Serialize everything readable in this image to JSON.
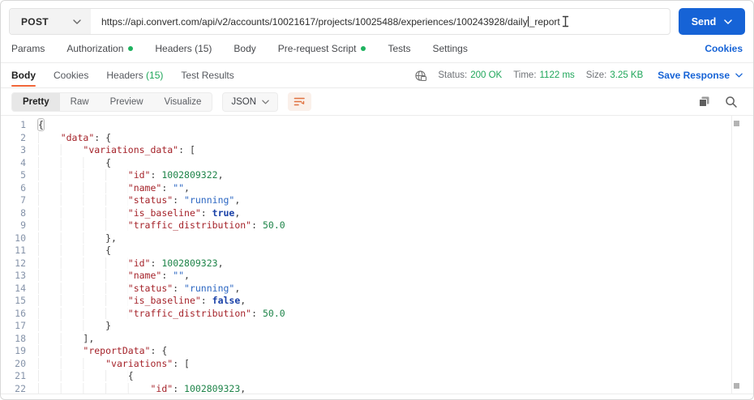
{
  "request_bar": {
    "method": "POST",
    "url_before_caret": "https://api.convert.com/api/v2/accounts/10021617/projects/10025488/experiences/100243928/daily",
    "url_after_caret": "_report",
    "send_label": "Send"
  },
  "request_tabs": {
    "items": [
      {
        "label": "Params",
        "dot": false
      },
      {
        "label": "Authorization",
        "dot": true
      },
      {
        "label": "Headers (15)",
        "dot": false
      },
      {
        "label": "Body",
        "dot": false
      },
      {
        "label": "Pre-request Script",
        "dot": true
      },
      {
        "label": "Tests",
        "dot": false
      },
      {
        "label": "Settings",
        "dot": false
      }
    ],
    "cookies_link": "Cookies"
  },
  "response_bar": {
    "tabs": [
      {
        "label": "Body",
        "count": "",
        "active": true
      },
      {
        "label": "Cookies",
        "count": "",
        "active": false
      },
      {
        "label": "Headers",
        "count": "(15)",
        "active": false
      },
      {
        "label": "Test Results",
        "count": "",
        "active": false
      }
    ],
    "stats": [
      {
        "label": "Status:",
        "value": "200 OK"
      },
      {
        "label": "Time:",
        "value": "1122 ms"
      },
      {
        "label": "Size:",
        "value": "3.25 KB"
      }
    ],
    "save_response_label": "Save Response"
  },
  "body_toolbar": {
    "views": [
      {
        "label": "Pretty",
        "active": true
      },
      {
        "label": "Raw",
        "active": false
      },
      {
        "label": "Preview",
        "active": false
      },
      {
        "label": "Visualize",
        "active": false
      }
    ],
    "language": "JSON",
    "icons": [
      "wrap-text-icon",
      "copy-icon",
      "search-icon"
    ]
  },
  "code": {
    "lines": [
      [
        1,
        [
          [
            "bracem",
            "{"
          ]
        ]
      ],
      [
        2,
        [
          [
            "ws",
            "    "
          ],
          [
            "key",
            "\"data\""
          ],
          [
            "punct",
            ": {"
          ]
        ]
      ],
      [
        3,
        [
          [
            "ws",
            "        "
          ],
          [
            "key",
            "\"variations_data\""
          ],
          [
            "punct",
            ": ["
          ]
        ]
      ],
      [
        4,
        [
          [
            "ws",
            "            "
          ],
          [
            "punct",
            "{"
          ]
        ]
      ],
      [
        5,
        [
          [
            "ws",
            "                "
          ],
          [
            "key",
            "\"id\""
          ],
          [
            "punct",
            ": "
          ],
          [
            "num",
            "1002809322"
          ],
          [
            "punct",
            ","
          ]
        ]
      ],
      [
        6,
        [
          [
            "ws",
            "                "
          ],
          [
            "key",
            "\"name\""
          ],
          [
            "punct",
            ": "
          ],
          [
            "str",
            "\"\""
          ],
          [
            "punct",
            ","
          ]
        ]
      ],
      [
        7,
        [
          [
            "ws",
            "                "
          ],
          [
            "key",
            "\"status\""
          ],
          [
            "punct",
            ": "
          ],
          [
            "str",
            "\"running\""
          ],
          [
            "punct",
            ","
          ]
        ]
      ],
      [
        8,
        [
          [
            "ws",
            "                "
          ],
          [
            "key",
            "\"is_baseline\""
          ],
          [
            "punct",
            ": "
          ],
          [
            "bool",
            "true"
          ],
          [
            "punct",
            ","
          ]
        ]
      ],
      [
        9,
        [
          [
            "ws",
            "                "
          ],
          [
            "key",
            "\"traffic_distribution\""
          ],
          [
            "punct",
            ": "
          ],
          [
            "num",
            "50.0"
          ]
        ]
      ],
      [
        10,
        [
          [
            "ws",
            "            "
          ],
          [
            "punct",
            "},"
          ]
        ]
      ],
      [
        11,
        [
          [
            "ws",
            "            "
          ],
          [
            "punct",
            "{"
          ]
        ]
      ],
      [
        12,
        [
          [
            "ws",
            "                "
          ],
          [
            "key",
            "\"id\""
          ],
          [
            "punct",
            ": "
          ],
          [
            "num",
            "1002809323"
          ],
          [
            "punct",
            ","
          ]
        ]
      ],
      [
        13,
        [
          [
            "ws",
            "                "
          ],
          [
            "key",
            "\"name\""
          ],
          [
            "punct",
            ": "
          ],
          [
            "str",
            "\"\""
          ],
          [
            "punct",
            ","
          ]
        ]
      ],
      [
        14,
        [
          [
            "ws",
            "                "
          ],
          [
            "key",
            "\"status\""
          ],
          [
            "punct",
            ": "
          ],
          [
            "str",
            "\"running\""
          ],
          [
            "punct",
            ","
          ]
        ]
      ],
      [
        15,
        [
          [
            "ws",
            "                "
          ],
          [
            "key",
            "\"is_baseline\""
          ],
          [
            "punct",
            ": "
          ],
          [
            "bool",
            "false"
          ],
          [
            "punct",
            ","
          ]
        ]
      ],
      [
        16,
        [
          [
            "ws",
            "                "
          ],
          [
            "key",
            "\"traffic_distribution\""
          ],
          [
            "punct",
            ": "
          ],
          [
            "num",
            "50.0"
          ]
        ]
      ],
      [
        17,
        [
          [
            "ws",
            "            "
          ],
          [
            "punct",
            "}"
          ]
        ]
      ],
      [
        18,
        [
          [
            "ws",
            "        "
          ],
          [
            "punct",
            "],"
          ]
        ]
      ],
      [
        19,
        [
          [
            "ws",
            "        "
          ],
          [
            "key",
            "\"reportData\""
          ],
          [
            "punct",
            ": {"
          ]
        ]
      ],
      [
        20,
        [
          [
            "ws",
            "            "
          ],
          [
            "key",
            "\"variations\""
          ],
          [
            "punct",
            ": ["
          ]
        ]
      ],
      [
        21,
        [
          [
            "ws",
            "                "
          ],
          [
            "punct",
            "{"
          ]
        ]
      ],
      [
        22,
        [
          [
            "ws",
            "                    "
          ],
          [
            "key",
            "\"id\""
          ],
          [
            "punct",
            ": "
          ],
          [
            "num",
            "1002809323"
          ],
          [
            "punct",
            ","
          ]
        ]
      ]
    ]
  },
  "colors": {
    "accent_blue": "#1663D6",
    "accent_orange": "#F16639",
    "success_green": "#1FA65A",
    "dot_green": "#1FB25F",
    "json_key": "#A5232A",
    "json_string": "#2B66C2",
    "json_number": "#1E8449",
    "json_boolean": "#1A41A8"
  }
}
